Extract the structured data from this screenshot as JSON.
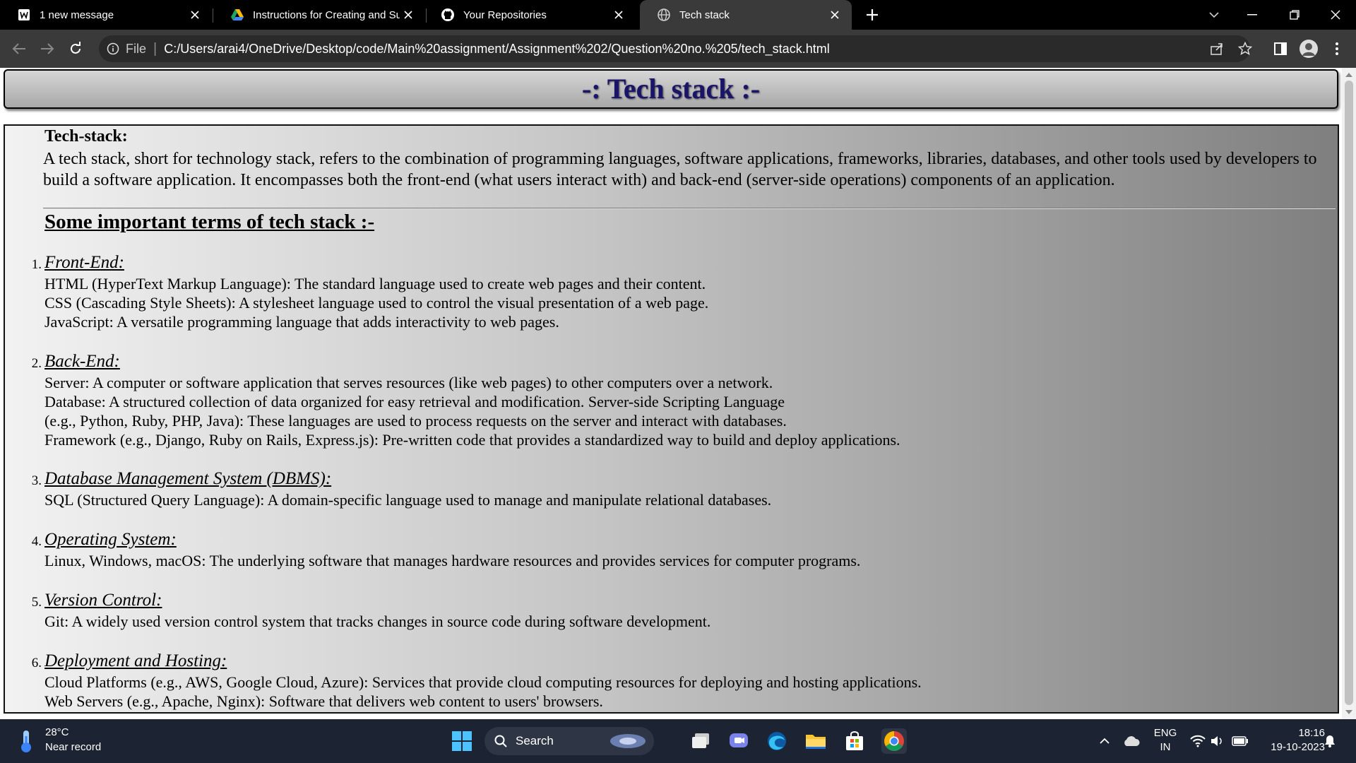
{
  "browser": {
    "tabs": [
      {
        "title": "1 new message",
        "icon": "mail-icon"
      },
      {
        "title": "Instructions for Creating and Sub",
        "icon": "drive-icon"
      },
      {
        "title": "Your Repositories",
        "icon": "github-icon"
      },
      {
        "title": "Tech stack",
        "icon": "globe-icon",
        "active": true
      }
    ],
    "scheme_label": "File",
    "url": "C:/Users/arai4/OneDrive/Desktop/code/Main%20assignment/Assignment%202/Question%20no.%205/tech_stack.html"
  },
  "page": {
    "header_title": "-: Tech stack :-",
    "section_title": "Tech-stack:",
    "intro": "A tech stack, short for technology stack, refers to the combination of programming languages, software applications, frameworks, libraries, databases, and other tools used by developers to build a software application. It encompasses both the front-end (what users interact with) and back-end (server-side operations) components of an application.",
    "terms_title": "Some important terms of tech stack :-",
    "terms": [
      {
        "num": "1.",
        "heading": "Front-End:",
        "lines": [
          "HTML (HyperText Markup Language): The standard language used to create web pages and their content.",
          "CSS (Cascading Style Sheets): A stylesheet language used to control the visual presentation of a web page.",
          "JavaScript: A versatile programming language that adds interactivity to web pages."
        ]
      },
      {
        "num": "2.",
        "heading": "Back-End:",
        "lines": [
          "Server: A computer or software application that serves resources (like web pages) to other computers over a network.",
          "Database: A structured collection of data organized for easy retrieval and modification. Server-side Scripting Language",
          "(e.g., Python, Ruby, PHP, Java): These languages are used to process requests on the server and interact with databases.",
          "Framework (e.g., Django, Ruby on Rails, Express.js): Pre-written code that provides a standardized way to build and deploy applications."
        ]
      },
      {
        "num": "3.",
        "heading": "Database Management System (DBMS):",
        "lines": [
          "SQL (Structured Query Language): A domain-specific language used to manage and manipulate relational databases."
        ]
      },
      {
        "num": "4.",
        "heading": "Operating System:",
        "lines": [
          "Linux, Windows, macOS: The underlying software that manages hardware resources and provides services for computer programs."
        ]
      },
      {
        "num": "5.",
        "heading": "Version Control:",
        "lines": [
          "Git: A widely used version control system that tracks changes in source code during software development."
        ]
      },
      {
        "num": "6.",
        "heading": "Deployment and Hosting:",
        "lines": [
          "Cloud Platforms (e.g., AWS, Google Cloud, Azure): Services that provide cloud computing resources for deploying and hosting applications.",
          "Web Servers (e.g., Apache, Nginx): Software that delivers web content to users' browsers."
        ]
      }
    ]
  },
  "taskbar": {
    "weather_temp": "28°C",
    "weather_note": "Near record",
    "search_label": "Search",
    "lang_line1": "ENG",
    "lang_line2": "IN",
    "time": "18:16",
    "date": "19-10-2023"
  }
}
